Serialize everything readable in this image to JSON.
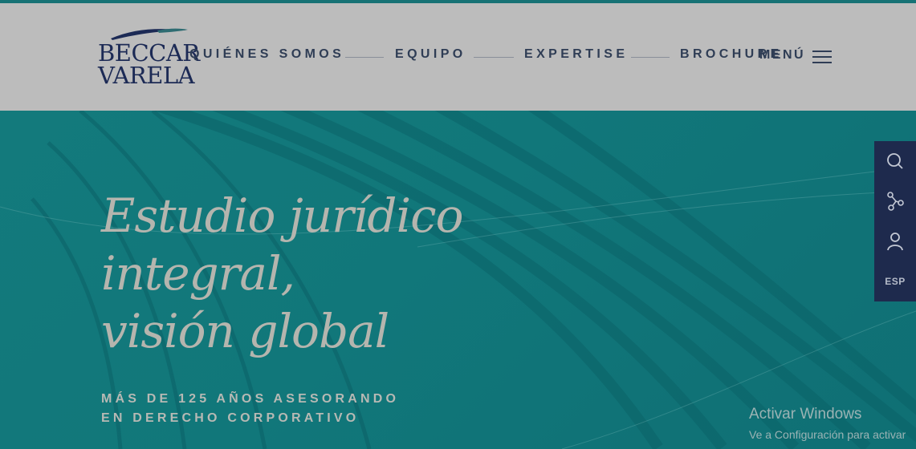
{
  "logo": {
    "line1": "BECCAR",
    "line2": "VARELA"
  },
  "nav": {
    "items": [
      "QUIÉNES SOMOS",
      "EQUIPO",
      "EXPERTISE",
      "BROCHURE"
    ]
  },
  "menu": {
    "label": "MENÚ",
    "icon": "hamburger-icon"
  },
  "hero": {
    "headline": [
      "Estudio jurídico",
      "integral,",
      "visión global"
    ],
    "subline": [
      "MÁS DE 125 AÑOS ASESORANDO",
      "EN DERECHO CORPORATIVO"
    ]
  },
  "side_toolbar": {
    "icons": [
      "search-icon",
      "share-icon",
      "user-icon"
    ],
    "lang": "ESP"
  },
  "watermark": {
    "title": "Activar Windows",
    "subtitle": "Ve a Configuración para activar"
  },
  "colors": {
    "header_bg": "#bcbcbc",
    "hero_bg": "#127a7b",
    "navy": "#1e2a4d",
    "text_dark": "#2f3d55"
  }
}
